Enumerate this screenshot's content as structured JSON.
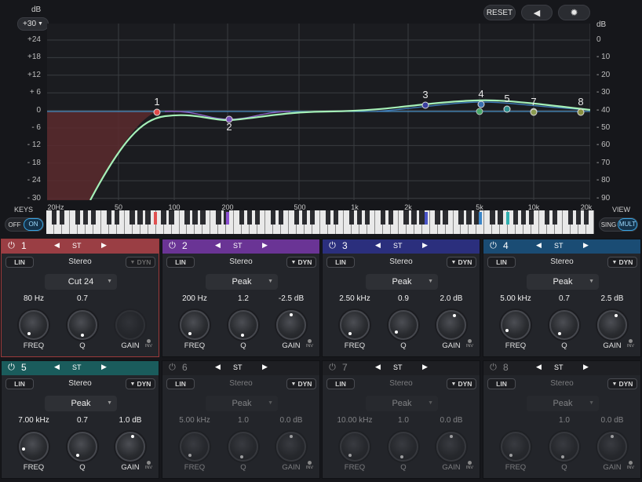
{
  "header": {
    "db_label_left": "dB",
    "range_value": "+30",
    "db_label_right": "dB",
    "reset_label": "RESET"
  },
  "icons": {
    "speaker": "speaker-icon",
    "settings": "gear-icon",
    "power": "power-icon"
  },
  "scale_left": [
    "+24",
    "+18",
    "+12",
    "+ 6",
    "0",
    "- 6",
    "- 12",
    "- 18",
    "- 24",
    "- 30"
  ],
  "scale_right": [
    "0",
    "- 10",
    "- 20",
    "- 30",
    "- 40",
    "- 50",
    "- 60",
    "- 70",
    "- 80",
    "- 90"
  ],
  "freq_labels": [
    "20Hz",
    "50",
    "100",
    "200",
    "500",
    "1k",
    "2k",
    "5k",
    "10k",
    "20k"
  ],
  "keys": {
    "label": "KEYS",
    "off": "OFF",
    "on": "ON"
  },
  "view": {
    "label": "VIEW",
    "sing": "SING",
    "mult": "MULT"
  },
  "eq_points": [
    "1",
    "2",
    "3",
    "4",
    "5",
    "7",
    "8"
  ],
  "colors": {
    "band1": "#a8464d",
    "band2": "#7b2fa6",
    "band3": "#2c2f7a",
    "band4": "#1c4c73",
    "band5": "#1d5e5e",
    "curve": "#9ff0b5",
    "grid": "#3a3c41"
  },
  "bands": [
    {
      "num": "1",
      "st": "ST",
      "channel": "Stereo",
      "lin": "LIN",
      "dyn": "DYN",
      "type": "Cut 24",
      "freq": "80 Hz",
      "q": "0.7",
      "gain": "",
      "freq_label": "FREQ",
      "q_label": "Q",
      "gain_label": "GAIN",
      "inv": "INV"
    },
    {
      "num": "2",
      "st": "ST",
      "channel": "Stereo",
      "lin": "LIN",
      "dyn": "DYN",
      "type": "Peak",
      "freq": "200 Hz",
      "q": "1.2",
      "gain": "-2.5 dB",
      "freq_label": "FREQ",
      "q_label": "Q",
      "gain_label": "GAIN",
      "inv": "INV"
    },
    {
      "num": "3",
      "st": "ST",
      "channel": "Stereo",
      "lin": "LIN",
      "dyn": "DYN",
      "type": "Peak",
      "freq": "2.50 kHz",
      "q": "0.9",
      "gain": "2.0 dB",
      "freq_label": "FREQ",
      "q_label": "Q",
      "gain_label": "GAIN",
      "inv": "INV"
    },
    {
      "num": "4",
      "st": "ST",
      "channel": "Stereo",
      "lin": "LIN",
      "dyn": "DYN",
      "type": "Peak",
      "freq": "5.00 kHz",
      "q": "0.7",
      "gain": "2.5 dB",
      "freq_label": "FREQ",
      "q_label": "Q",
      "gain_label": "GAIN",
      "inv": "INV"
    },
    {
      "num": "5",
      "st": "ST",
      "channel": "Stereo",
      "lin": "LIN",
      "dyn": "DYN",
      "type": "Peak",
      "freq": "7.00 kHz",
      "q": "0.7",
      "gain": "1.0 dB",
      "freq_label": "FREQ",
      "q_label": "Q",
      "gain_label": "GAIN",
      "inv": "INV"
    },
    {
      "num": "6",
      "st": "ST",
      "channel": "Stereo",
      "lin": "LIN",
      "dyn": "DYN",
      "type": "Peak",
      "freq": "5.00 kHz",
      "q": "1.0",
      "gain": "0.0 dB",
      "freq_label": "FREQ",
      "q_label": "Q",
      "gain_label": "GAIN",
      "inv": "INV"
    },
    {
      "num": "7",
      "st": "ST",
      "channel": "Stereo",
      "lin": "LIN",
      "dyn": "DYN",
      "type": "Peak",
      "freq": "10.00 kHz",
      "q": "1.0",
      "gain": "0.0 dB",
      "freq_label": "FREQ",
      "q_label": "Q",
      "gain_label": "GAIN",
      "inv": "INV"
    },
    {
      "num": "8",
      "st": "ST",
      "channel": "Stereo",
      "lin": "LIN",
      "dyn": "DYN",
      "type": "Peak",
      "freq": "",
      "q": "1.0",
      "gain": "0.0 dB",
      "freq_label": "FREQ",
      "q_label": "Q",
      "gain_label": "GAIN",
      "inv": "INV"
    }
  ]
}
